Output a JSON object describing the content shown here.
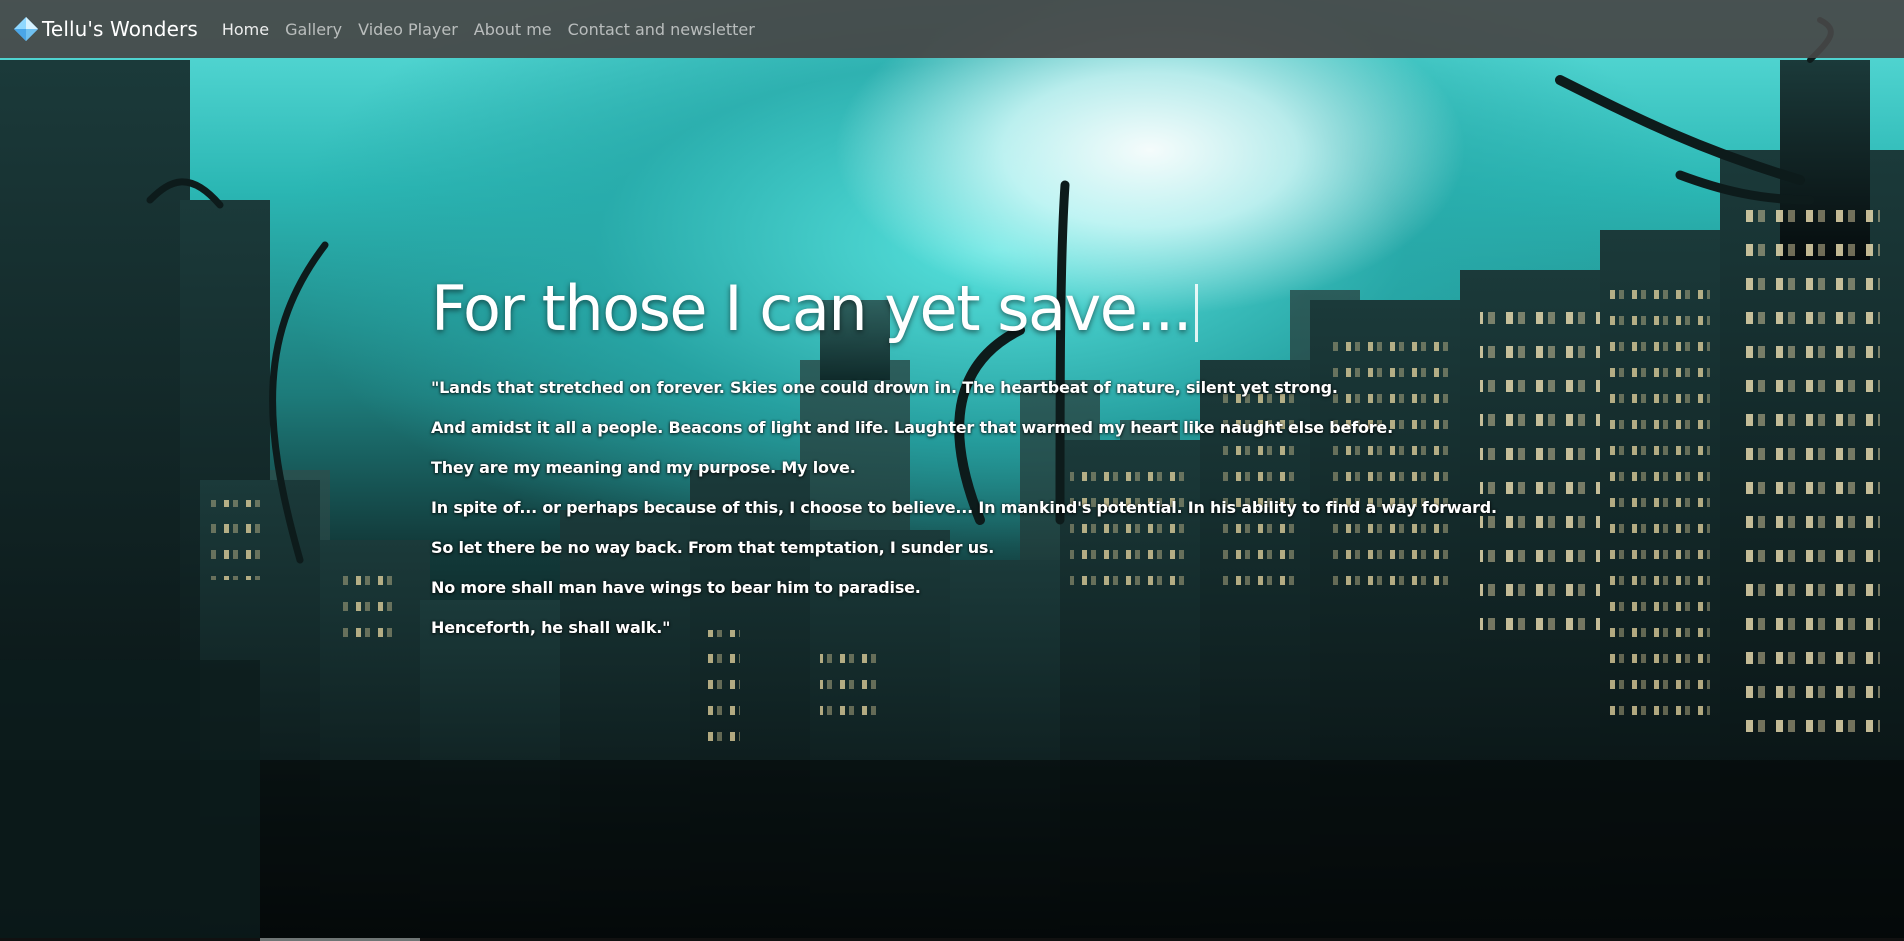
{
  "nav": {
    "brand": "Tellu's Wonders",
    "links": [
      {
        "label": "Home"
      },
      {
        "label": "Gallery"
      },
      {
        "label": "Video Player"
      },
      {
        "label": "About me"
      },
      {
        "label": "Contact and newsletter"
      }
    ],
    "active_link": "Home"
  },
  "hero": {
    "headline": "For those I can yet save...",
    "quote_lines": [
      "\"Lands that stretched on forever. Skies one could drown in. The heartbeat of nature, silent yet strong.",
      "And amidst it all a people. Beacons of light and life. Laughter that warmed my heart like naught else before.",
      "They are my meaning and my purpose. My love.",
      "In spite of... or perhaps because of this, I choose to believe... In mankind's potential. In his ability to find a way forward.",
      "So let there be no way back. From that temptation, I sunder us.",
      "No more shall man have wings to bear him to paradise.",
      "Henceforth, he shall walk.\""
    ]
  },
  "icons": {
    "brand_logo": "diamond-gem-icon"
  },
  "colors": {
    "navbar_bg": "#464646",
    "sky_cyan": "#2bb7b4",
    "text": "#ffffff"
  }
}
